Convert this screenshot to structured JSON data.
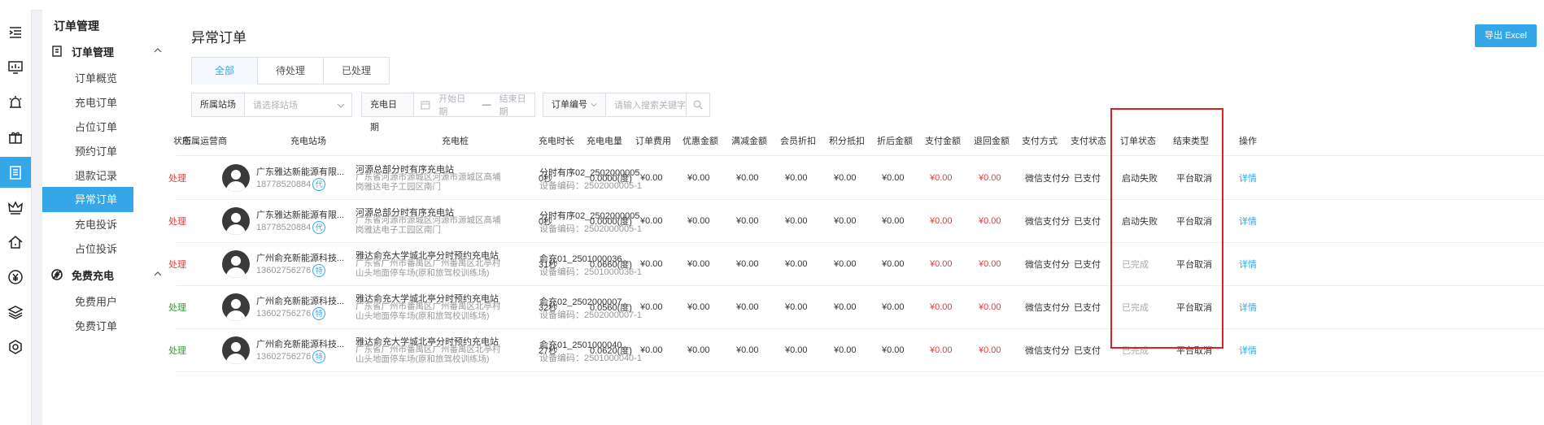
{
  "sidebar": {
    "title": "订单管理",
    "groups": [
      {
        "label": "订单管理",
        "icon": "clipboard-icon",
        "items": [
          "订单概览",
          "充电订单",
          "占位订单",
          "预约订单",
          "退款记录",
          "异常订单",
          "充电投诉",
          "占位投诉"
        ]
      },
      {
        "label": "免费充电",
        "icon": "no-charge-icon",
        "items": [
          "免费用户",
          "免费订单"
        ]
      }
    ],
    "active_item": "异常订单"
  },
  "iconbar": [
    "menu-toggle-icon",
    "dashboard-icon",
    "alarm-icon",
    "gift-icon",
    "order-icon",
    "crown-icon",
    "home-icon",
    "yen-icon",
    "layers-icon",
    "settings-icon"
  ],
  "main": {
    "title": "异常订单",
    "export_label": "导出 Excel",
    "tabs": [
      "全部",
      "待处理",
      "已处理"
    ],
    "active_tab": "全部",
    "filters": {
      "station_label": "所属站场",
      "station_placeholder": "请选择站场",
      "date_label": "充电日期",
      "start_placeholder": "开始日期",
      "date_sep": "—",
      "end_placeholder": "结束日期",
      "order_label": "订单编号",
      "order_placeholder": "请输入搜索关键字"
    },
    "columns": [
      "状态",
      "所属运营商",
      "充电站场",
      "充电桩",
      "充电时长",
      "充电电量",
      "订单费用",
      "优惠金额",
      "满减金额",
      "会员折扣",
      "积分抵扣",
      "折后金额",
      "支付金额",
      "退回金额",
      "支付方式",
      "支付状态",
      "订单状态",
      "结束类型",
      "操作"
    ],
    "rows": [
      {
        "status": "处理",
        "status_color": "#e4393c",
        "operator": "广东雅达新能源有限...",
        "phone": "18778520884",
        "badge": "代",
        "station": "河源总部分时有序充电站",
        "address": "广东省河源市源城区河源市源城区高埔岗雅达电子工园区南门",
        "pile": "分时有序02_2502000005",
        "pile_code": "设备编码：2502000005-1",
        "duration": "0秒",
        "energy": "0.0000(度)",
        "fee": "¥0.00",
        "discount": "¥0.00",
        "full_reduce": "¥0.00",
        "member": "¥0.00",
        "points": "¥0.00",
        "after": "¥0.00",
        "paid": "¥0.00",
        "refund": "¥0.00",
        "pay_method": "微信支付分",
        "pay_status": "已支付",
        "order_status": "启动失败",
        "end_type": "平台取消",
        "action": "详情"
      },
      {
        "status": "处理",
        "status_color": "#e4393c",
        "operator": "广东雅达新能源有限...",
        "phone": "18778520884",
        "badge": "代",
        "station": "河源总部分时有序充电站",
        "address": "广东省河源市源城区河源市源城区高埔岗雅达电子工园区南门",
        "pile": "分时有序02_2502000005",
        "pile_code": "设备编码：2502000005-1",
        "duration": "0秒",
        "energy": "0.0000(度)",
        "fee": "¥0.00",
        "discount": "¥0.00",
        "full_reduce": "¥0.00",
        "member": "¥0.00",
        "points": "¥0.00",
        "after": "¥0.00",
        "paid": "¥0.00",
        "refund": "¥0.00",
        "pay_method": "微信支付分",
        "pay_status": "已支付",
        "order_status": "启动失败",
        "end_type": "平台取消",
        "action": "详情"
      },
      {
        "status": "处理",
        "status_color": "#e4393c",
        "operator": "广州俞充新能源科技...",
        "phone": "13602756276",
        "badge": "特",
        "station": "雅达俞充大学城北亭分时预约充电站",
        "address": "广东省广州市番禺区广州番禺区北亭村山头地面停车场(原和旅驾校训练场)",
        "pile": "俞充01_2501000036",
        "pile_code": "设备编码：2501000036-1",
        "duration": "31秒",
        "energy": "0.0660(度)",
        "fee": "¥0.00",
        "discount": "¥0.00",
        "full_reduce": "¥0.00",
        "member": "¥0.00",
        "points": "¥0.00",
        "after": "¥0.00",
        "paid": "¥0.00",
        "refund": "¥0.00",
        "pay_method": "微信支付分",
        "pay_status": "已支付",
        "order_status": "已完成",
        "end_type": "平台取消",
        "action": "详情"
      },
      {
        "status": "处理",
        "status_color": "#2e9b2e",
        "operator": "广州俞充新能源科技...",
        "phone": "13602756276",
        "badge": "特",
        "station": "雅达俞充大学城北亭分时预约充电站",
        "address": "广东省广州市番禺区广州番禺区北亭村山头地面停车场(原和旅驾校训练场)",
        "pile": "俞充02_2502000007",
        "pile_code": "设备编码：2502000007-1",
        "duration": "32秒",
        "energy": "0.0560(度)",
        "fee": "¥0.00",
        "discount": "¥0.00",
        "full_reduce": "¥0.00",
        "member": "¥0.00",
        "points": "¥0.00",
        "after": "¥0.00",
        "paid": "¥0.00",
        "refund": "¥0.00",
        "pay_method": "微信支付分",
        "pay_status": "已支付",
        "order_status": "已完成",
        "end_type": "平台取消",
        "action": "详情"
      },
      {
        "status": "处理",
        "status_color": "#2e9b2e",
        "operator": "广州俞充新能源科技...",
        "phone": "13602756276",
        "badge": "特",
        "station": "雅达俞充大学城北亭分时预约充电站",
        "address": "广东省广州市番禺区广州番禺区北亭村山头地面停车场(原和旅驾校训练场)",
        "pile": "俞充01_2501000040",
        "pile_code": "设备编码：2501000040-1",
        "duration": "27秒",
        "energy": "0.0620(度)",
        "fee": "¥0.00",
        "discount": "¥0.00",
        "full_reduce": "¥0.00",
        "member": "¥0.00",
        "points": "¥0.00",
        "after": "¥0.00",
        "paid": "¥0.00",
        "refund": "¥0.00",
        "pay_method": "微信支付分",
        "pay_status": "已支付",
        "order_status": "已完成",
        "end_type": "平台取消",
        "action": "详情"
      }
    ]
  },
  "colors": {
    "accent": "#35a7e8",
    "red": "#e4393c",
    "green": "#2e9b2e",
    "highlight": "#e02020"
  }
}
